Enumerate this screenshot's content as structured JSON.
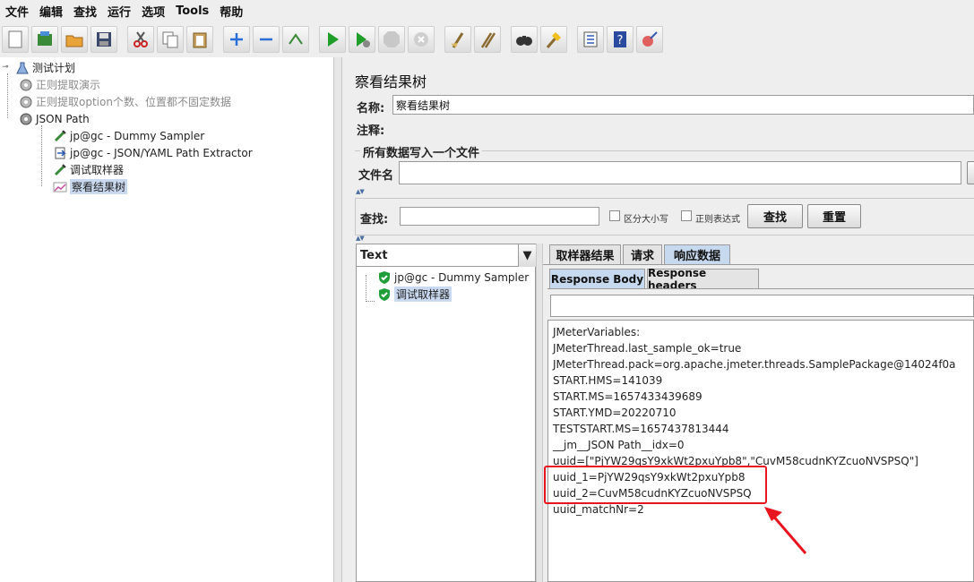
{
  "menu": [
    "文件",
    "编辑",
    "查找",
    "运行",
    "选项",
    "Tools",
    "帮助"
  ],
  "toolbar_icons": [
    "new-icon",
    "templates-icon",
    "open-icon",
    "save-icon",
    "cut-icon",
    "copy-icon",
    "paste-icon",
    "expand-icon",
    "collapse-icon",
    "toggle-icon",
    "start-icon",
    "start-no-pause-icon",
    "stop-icon",
    "shutdown-icon",
    "clear-icon",
    "clear-all-icon",
    "search-icon",
    "reset-search-icon",
    "function-helper-icon",
    "help-icon",
    "remote-icon"
  ],
  "test_tree": {
    "root": "测试计划",
    "items": [
      {
        "label": "正则提取演示",
        "disabled": true
      },
      {
        "label": "正则提取option个数、位置都不固定数据",
        "disabled": true
      },
      {
        "label": "JSON Path",
        "disabled": false
      },
      {
        "label": "jp@gc - Dummy Sampler"
      },
      {
        "label": "jp@gc - JSON/YAML Path Extractor"
      },
      {
        "label": "调试取样器"
      },
      {
        "label": "察看结果树"
      }
    ]
  },
  "panel": {
    "title": "察看结果树",
    "name_label": "名称:",
    "name_value": "察看结果树",
    "comment_label": "注释:",
    "comment_value": "",
    "write_all_label": "所有数据写入一个文件",
    "filename_label": "文件名",
    "filename_value": ""
  },
  "search": {
    "label": "查找:",
    "value": "",
    "case_label": "区分大小写",
    "regex_label": "正则表达式",
    "find_button": "查找",
    "reset_button": "重置"
  },
  "results": {
    "renderer": "Text",
    "samples": [
      "jp@gc - Dummy Sampler",
      "调试取样器"
    ]
  },
  "tabs": [
    "取样器结果",
    "请求",
    "响应数据"
  ],
  "active_tab": "响应数据",
  "subtabs": [
    "Response Body",
    "Response headers"
  ],
  "active_subtab": "Response Body",
  "response_body_lines": [
    "JMeterVariables:",
    "JMeterThread.last_sample_ok=true",
    "JMeterThread.pack=org.apache.jmeter.threads.SamplePackage@14024f0a",
    "START.HMS=141039",
    "START.MS=1657433439689",
    "START.YMD=20220710",
    "TESTSTART.MS=1657437813444",
    "__jm__JSON Path__idx=0",
    "uuid=[\"PjYW29qsY9xkWt2pxuYpb8\",\"CuvM58cudnKYZcuoNVSPSQ\"]",
    "uuid_1=PjYW29qsY9xkWt2pxuYpb8",
    "uuid_2=CuvM58cudnKYZcuoNVSPSQ",
    "uuid_matchNr=2"
  ],
  "annotation_color": "#e8141e"
}
